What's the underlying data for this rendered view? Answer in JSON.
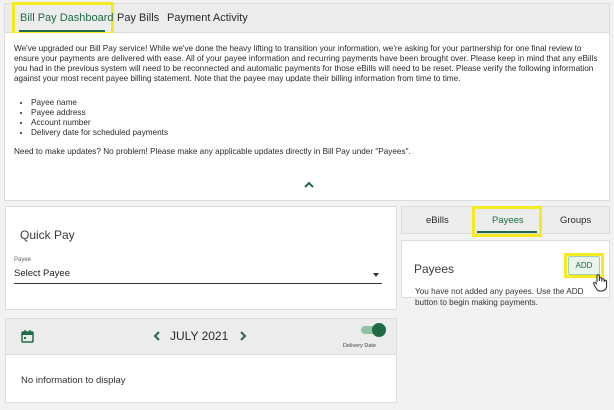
{
  "nav": {
    "tabs": [
      {
        "label": "Bill Pay Dashboard"
      },
      {
        "label": "Pay Bills"
      },
      {
        "label": "Payment Activity"
      }
    ]
  },
  "notice": {
    "intro": "We've upgraded our Bill Pay service! While we've done the heavy lifting to transition your information, we're asking for your partnership for one final review to ensure your payments are delivered with ease. All of your payee information and recurring payments have been brought over. Please keep in mind that any eBills you had in the previous system will need to be reconnected and automatic payments for those eBills will need to be reset. Please verify the following information against your most recent payee billing statement. Note that the payee may update their billing information from time to time.",
    "items": [
      "Payee name",
      "Payee address",
      "Account number",
      "Delivery date for scheduled payments"
    ],
    "updates": "Need to make updates? No problem! Please make any applicable updates directly in Bill Pay under \"Payees\".",
    "collapse_icon": "chevron-up-icon"
  },
  "quick_pay": {
    "title": "Quick Pay",
    "payee_label": "Payee",
    "payee_value": "Select Payee"
  },
  "calendar": {
    "calendar_icon": "calendar-icon",
    "month": "JULY 2021",
    "toggle_label": "Delivery Date",
    "toggle_on": true,
    "empty_message": "No information to display"
  },
  "subtabs": {
    "tabs": [
      {
        "label": "eBills"
      },
      {
        "label": "Payees"
      },
      {
        "label": "Groups"
      }
    ]
  },
  "payees": {
    "title": "Payees",
    "add_label": "ADD",
    "message": "You have not added any payees. Use the ADD button to begin making payments."
  },
  "colors": {
    "accent": "#1f6b46",
    "highlight": "#f4ea1f",
    "toggle_track": "#8fc1a6"
  }
}
